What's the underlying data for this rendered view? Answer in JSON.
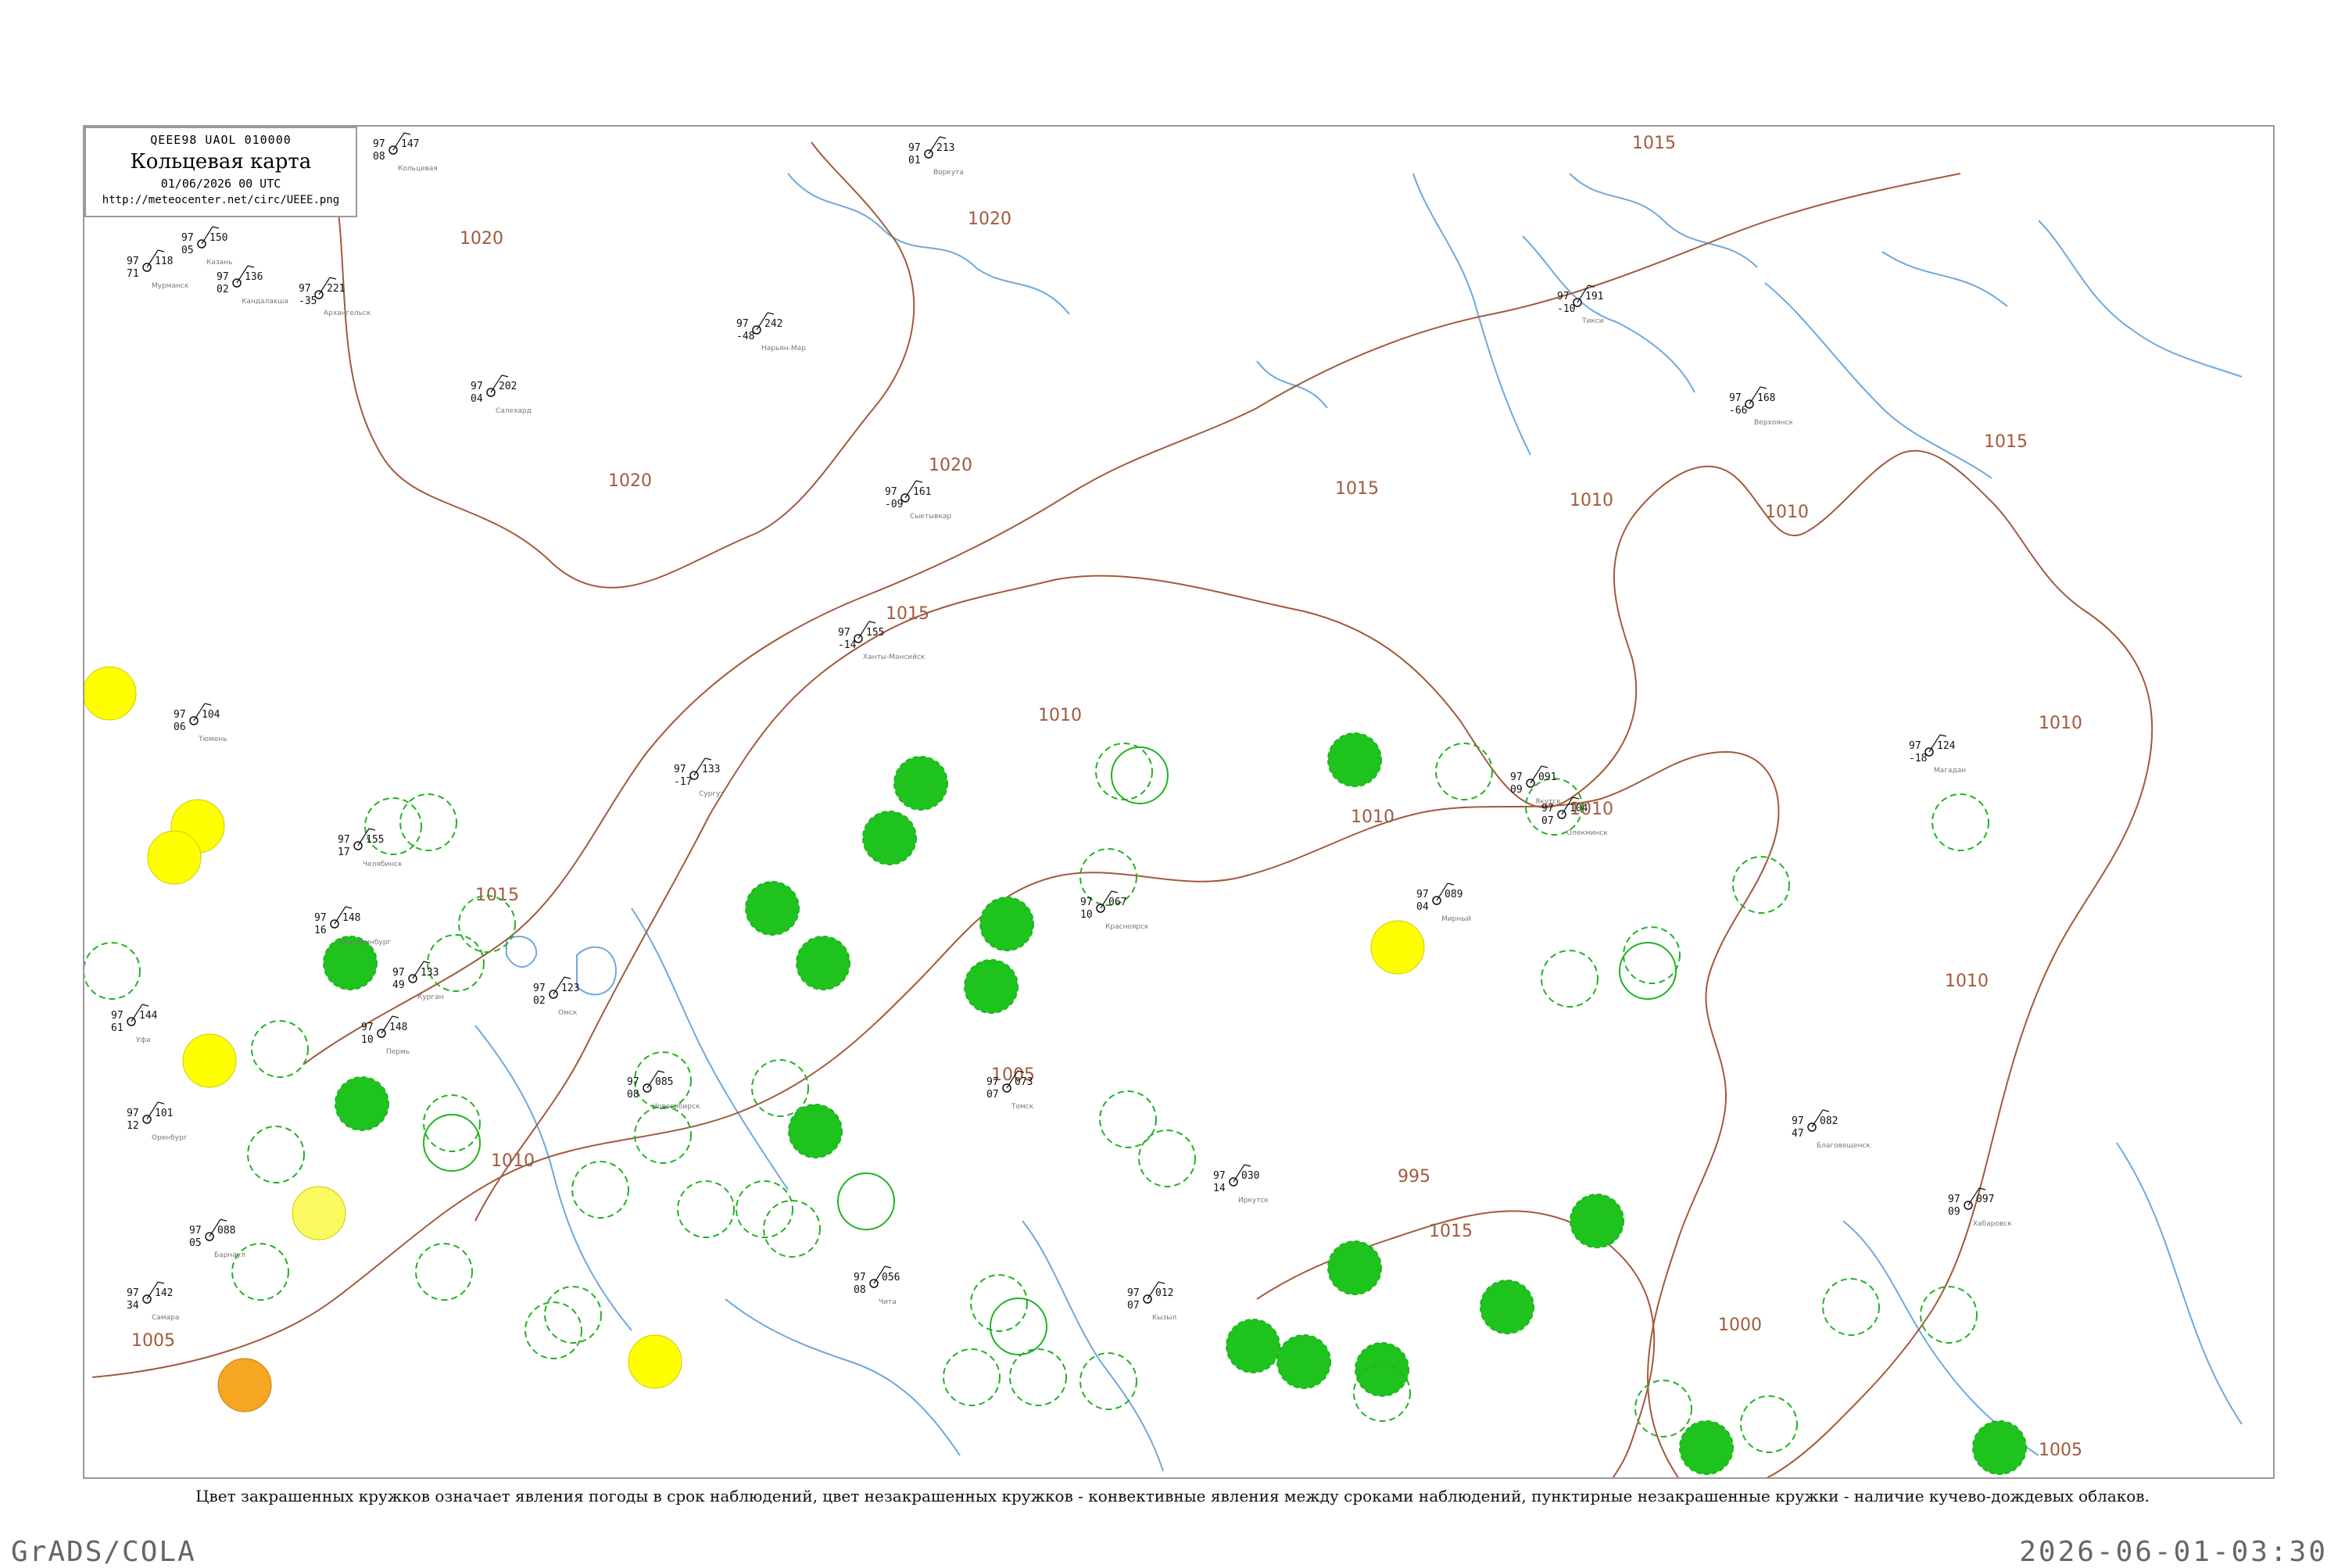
{
  "header": {
    "code": "QEEE98  UAOL  010000",
    "title": "Кольцевая карта",
    "datetime": "01/06/2026 00 UTC",
    "url": "http://meteocenter.net/circ/UEEE.png"
  },
  "caption": "Цвет закрашенных кружков означает явления погоды в срок наблюдений, цвет незакрашенных кружков - конвективные явления между сроками наблюдений, пунктирные незакрашенные кружки - наличие кучево-дождевых облаков.",
  "footer": {
    "left": "GrADS/COLA",
    "right": "2026-06-01-03:30"
  },
  "colors": {
    "isobar": "#a15a3c",
    "rivers": "#6fa8dc",
    "storm_fill": "#1ec31e",
    "storm_ring": "#22b222",
    "yellow_fill": "#ffff00",
    "orange_fill": "#f5a623"
  },
  "isobar_labels": [
    "1020",
    "1020",
    "1020",
    "1020",
    "1015",
    "1015",
    "1015",
    "1015",
    "1015",
    "1010",
    "1010",
    "1010",
    "1010",
    "1010",
    "1010",
    "1010",
    "1010",
    "1005",
    "1005",
    "1005",
    "1000",
    "995",
    "1015"
  ],
  "stations": [
    {
      "name": "Кольцевая",
      "p": "147",
      "t": "97",
      "d": "08"
    },
    {
      "name": "Кандалакша",
      "p": "136",
      "t": "97",
      "d": "02"
    },
    {
      "name": "Мурманск",
      "p": "118",
      "t": "97",
      "d": "71"
    },
    {
      "name": "Архангельск",
      "p": "221",
      "t": "97",
      "d": "-35"
    },
    {
      "name": "Нарьян-Мар",
      "p": "242",
      "t": "97",
      "d": "-48"
    },
    {
      "name": "Воркута",
      "p": "213",
      "t": "97",
      "d": "01"
    },
    {
      "name": "Салехард",
      "p": "202",
      "t": "97",
      "d": "04"
    },
    {
      "name": "Сыктывкар",
      "p": "161",
      "t": "97",
      "d": "-09"
    },
    {
      "name": "Ханты-Мансийск",
      "p": "155",
      "t": "97",
      "d": "-14"
    },
    {
      "name": "Сургут",
      "p": "133",
      "t": "97",
      "d": "-17"
    },
    {
      "name": "Тюмень",
      "p": "104",
      "t": "97",
      "d": "06"
    },
    {
      "name": "Омск",
      "p": "123",
      "t": "97",
      "d": "02"
    },
    {
      "name": "Новосибирск",
      "p": "085",
      "t": "97",
      "d": "08"
    },
    {
      "name": "Томск",
      "p": "073",
      "t": "97",
      "d": "07"
    },
    {
      "name": "Красноярск",
      "p": "067",
      "t": "97",
      "d": "10"
    },
    {
      "name": "Иркутск",
      "p": "030",
      "t": "97",
      "d": "14"
    },
    {
      "name": "Кызыл",
      "p": "012",
      "t": "97",
      "d": "07"
    },
    {
      "name": "Барнаул",
      "p": "088",
      "t": "97",
      "d": "05"
    },
    {
      "name": "Уфа",
      "p": "144",
      "t": "97",
      "d": "61"
    },
    {
      "name": "Оренбург",
      "p": "101",
      "t": "97",
      "d": "12"
    },
    {
      "name": "Самара",
      "p": "142",
      "t": "97",
      "d": "34"
    },
    {
      "name": "Казань",
      "p": "150",
      "t": "97",
      "d": "05"
    },
    {
      "name": "Пермь",
      "p": "148",
      "t": "97",
      "d": "10"
    },
    {
      "name": "Екатеринбург",
      "p": "148",
      "t": "97",
      "d": "16"
    },
    {
      "name": "Челябинск",
      "p": "155",
      "t": "97",
      "d": "17"
    },
    {
      "name": "Курган",
      "p": "133",
      "t": "97",
      "d": "49"
    },
    {
      "name": "Якутск",
      "p": "091",
      "t": "97",
      "d": "09"
    },
    {
      "name": "Мирный",
      "p": "089",
      "t": "97",
      "d": "04"
    },
    {
      "name": "Олекминск",
      "p": "104",
      "t": "97",
      "d": "07"
    },
    {
      "name": "Тикси",
      "p": "191",
      "t": "97",
      "d": "-10"
    },
    {
      "name": "Верхоянск",
      "p": "168",
      "t": "97",
      "d": "-66"
    },
    {
      "name": "Чита",
      "p": "056",
      "t": "97",
      "d": "08"
    },
    {
      "name": "Благовещенск",
      "p": "082",
      "t": "97",
      "d": "47"
    },
    {
      "name": "Хабаровск",
      "p": "097",
      "t": "97",
      "d": "09"
    },
    {
      "name": "Магадан",
      "p": "124",
      "t": "97",
      "d": "-18"
    }
  ]
}
